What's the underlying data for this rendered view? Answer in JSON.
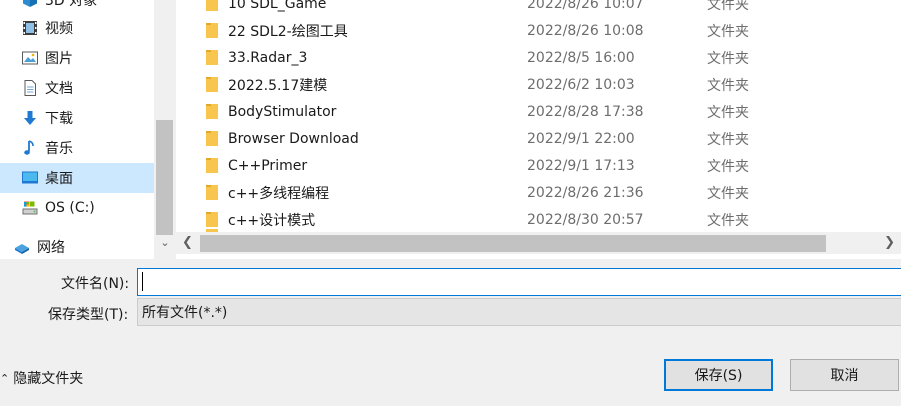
{
  "nav": {
    "items": [
      {
        "label": "3D 对象",
        "icon": "3d-objects-icon",
        "selected": false
      },
      {
        "label": "视频",
        "icon": "video-icon",
        "selected": false
      },
      {
        "label": "图片",
        "icon": "pictures-icon",
        "selected": false
      },
      {
        "label": "文档",
        "icon": "documents-icon",
        "selected": false
      },
      {
        "label": "下载",
        "icon": "downloads-icon",
        "selected": false
      },
      {
        "label": "音乐",
        "icon": "music-icon",
        "selected": false
      },
      {
        "label": "桌面",
        "icon": "desktop-icon",
        "selected": true
      },
      {
        "label": "OS (C:)",
        "icon": "drive-icon",
        "selected": false
      },
      {
        "label": "网络",
        "icon": "network-icon",
        "selected": false
      }
    ]
  },
  "files": [
    {
      "name": "10 SDL_Game",
      "date": "2022/8/26 10:07",
      "type": "文件夹"
    },
    {
      "name": "22 SDL2-绘图工具",
      "date": "2022/8/26 10:08",
      "type": "文件夹"
    },
    {
      "name": "33.Radar_3",
      "date": "2022/8/5 16:00",
      "type": "文件夹"
    },
    {
      "name": "2022.5.17建模",
      "date": "2022/6/2 10:03",
      "type": "文件夹"
    },
    {
      "name": "BodyStimulator",
      "date": "2022/8/28 17:38",
      "type": "文件夹"
    },
    {
      "name": "Browser Download",
      "date": "2022/9/1 22:00",
      "type": "文件夹"
    },
    {
      "name": "C++Primer",
      "date": "2022/9/1 17:13",
      "type": "文件夹"
    },
    {
      "name": "c++多线程编程",
      "date": "2022/8/26 21:36",
      "type": "文件夹"
    },
    {
      "name": "c++设计模式",
      "date": "2022/8/30 20:57",
      "type": "文件夹"
    }
  ],
  "form": {
    "filename_label": "文件名(N):",
    "filename_value": "",
    "filetype_label": "保存类型(T):",
    "filetype_value": "所有文件(*.*)"
  },
  "footer": {
    "hide_folders_label": "隐藏文件夹",
    "save_label": "保存(S)",
    "cancel_label": "取消"
  },
  "colors": {
    "accent": "#0078d7",
    "selected_bg": "#cce8ff",
    "folder": "#f8c64e"
  }
}
